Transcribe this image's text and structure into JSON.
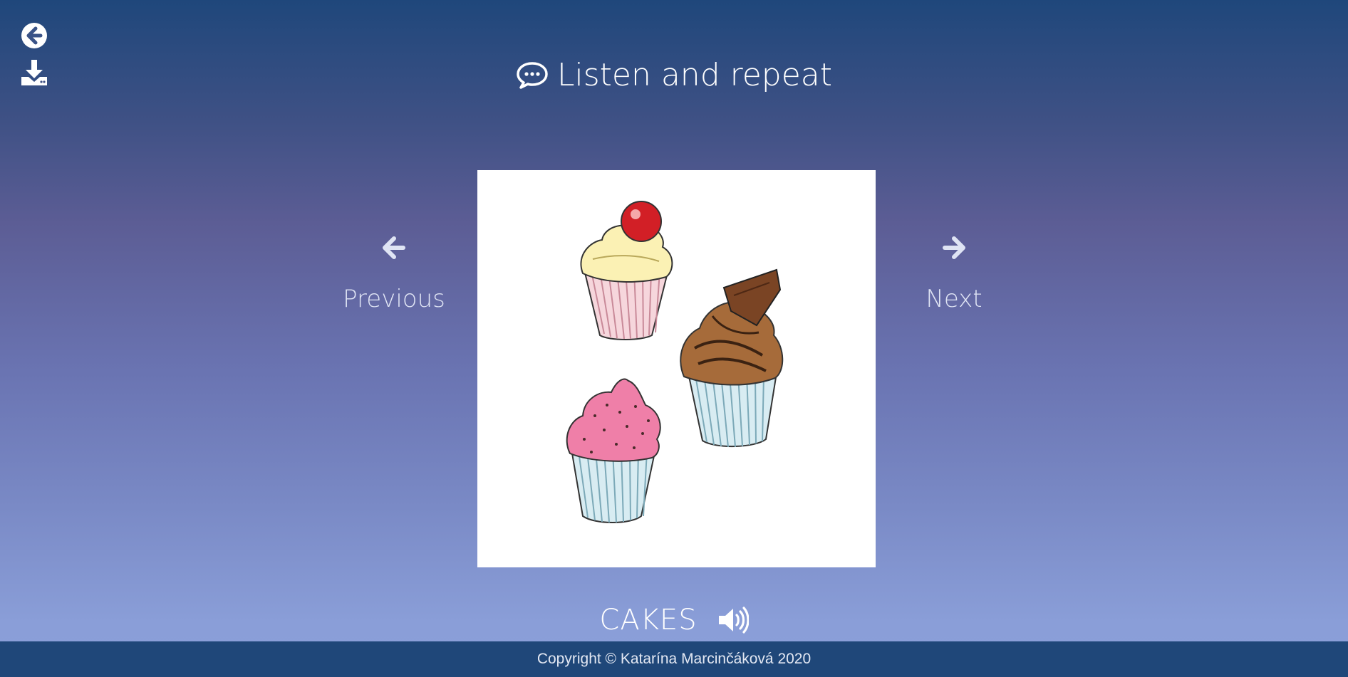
{
  "header": {
    "title": "Listen and repeat"
  },
  "nav": {
    "previous_label": "Previous",
    "next_label": "Next"
  },
  "card": {
    "word": "CAKES"
  },
  "footer": {
    "copyright": "Copyright © Katarína Marcinčáková 2020"
  },
  "icons": {
    "back": "circle-arrow-left-icon",
    "download": "download-icon",
    "chat": "chat-bubble-icon",
    "previous": "arrow-left-icon",
    "next": "arrow-right-icon",
    "speaker": "volume-icon"
  },
  "colors": {
    "background_top": "#1f477b",
    "background_bottom": "#8aa0da",
    "footer": "#1f4779",
    "text": "#ffffff"
  }
}
